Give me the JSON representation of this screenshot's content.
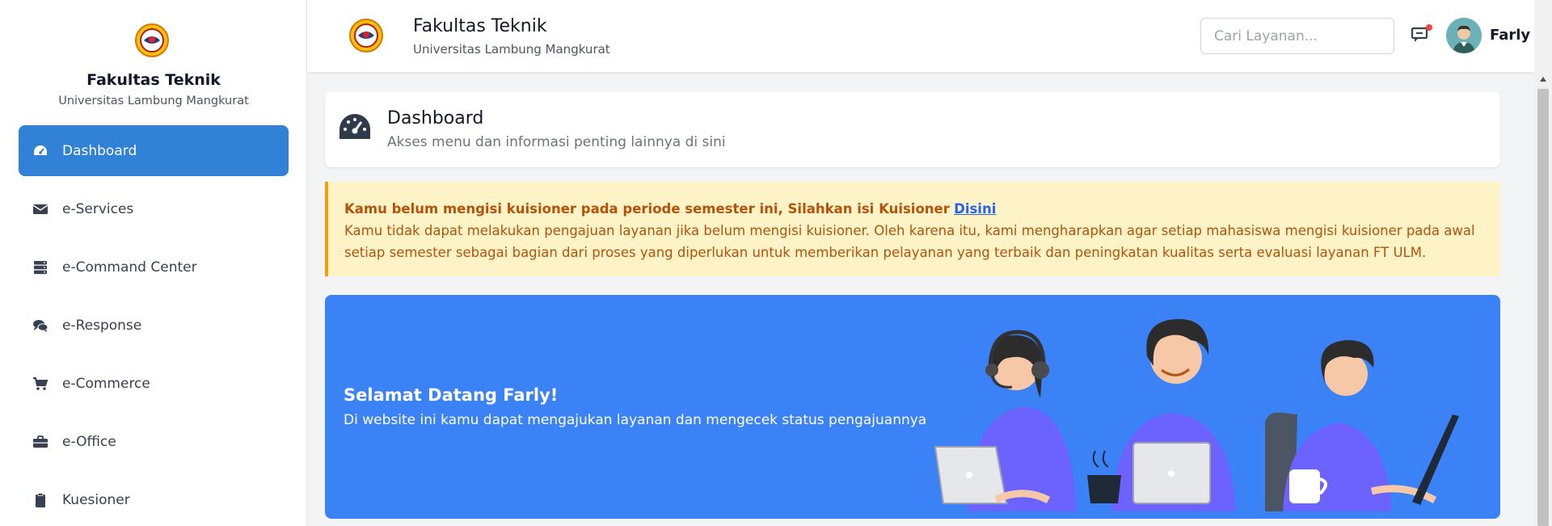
{
  "sidebar": {
    "title": "Fakultas Teknik",
    "subtitle": "Universitas Lambung Mangkurat",
    "items": [
      {
        "label": "Dashboard",
        "icon": "tachometer-icon",
        "active": true
      },
      {
        "label": "e-Services",
        "icon": "envelope-icon",
        "active": false
      },
      {
        "label": "e-Command Center",
        "icon": "server-icon",
        "active": false
      },
      {
        "label": "e-Response",
        "icon": "comments-icon",
        "active": false
      },
      {
        "label": "e-Commerce",
        "icon": "cart-icon",
        "active": false
      },
      {
        "label": "e-Office",
        "icon": "briefcase-icon",
        "active": false
      },
      {
        "label": "Kuesioner",
        "icon": "clipboard-icon",
        "active": false
      }
    ]
  },
  "header": {
    "title": "Fakultas Teknik",
    "subtitle": "Universitas Lambung Mangkurat",
    "search_placeholder": "Cari Layanan...",
    "username": "Farly"
  },
  "dashboard": {
    "title": "Dashboard",
    "subtitle": "Akses menu dan informasi penting lainnya di sini"
  },
  "alert": {
    "title": "Kamu belum mengisi kuisioner pada periode semester ini, Silahkan isi Kuisioner",
    "link": "Disini",
    "body": "Kamu tidak dapat melakukan pengajuan layanan jika belum mengisi kuisioner. Oleh karena itu, kami mengharapkan agar setiap mahasiswa mengisi kuisioner pada awal setiap semester sebagai bagian dari proses yang diperlukan untuk memberikan pelayanan yang terbaik dan peningkatan kualitas serta evaluasi layanan FT ULM."
  },
  "banner": {
    "title": "Selamat Datang Farly!",
    "subtitle": "Di website ini kamu dapat mengajukan layanan dan mengecek status pengajuannya"
  },
  "colors": {
    "accent": "#3181d6",
    "banner": "#3b82f6",
    "alert_bg": "#fef3c7",
    "alert_border": "#f59e0b",
    "alert_text": "#b45309",
    "notification_dot": "#ef4444"
  }
}
